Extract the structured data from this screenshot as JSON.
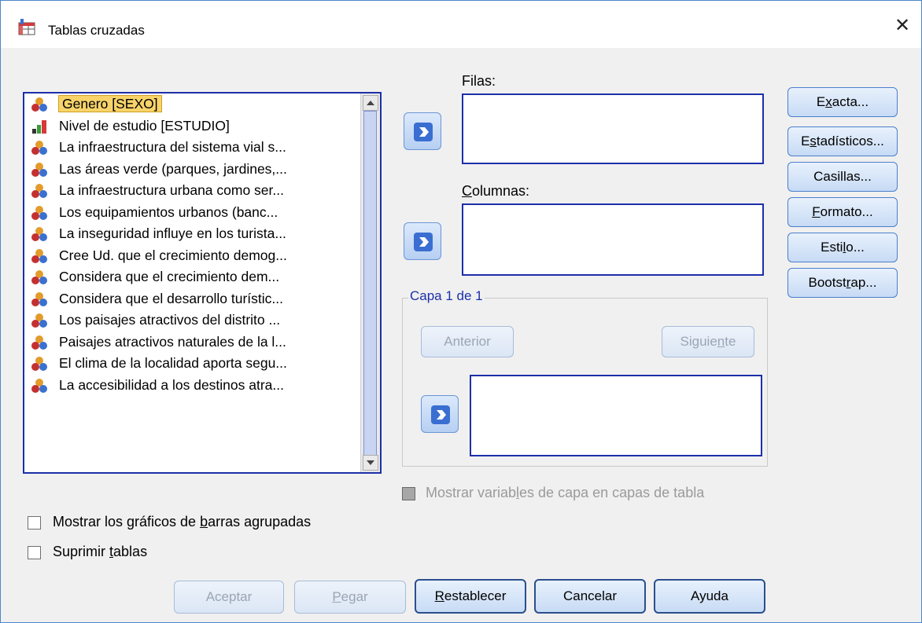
{
  "window": {
    "title": "Tablas cruzadas",
    "close_glyph": "✕"
  },
  "variables": [
    {
      "label": "Genero [SEXO]",
      "icon": "nominal-icon",
      "selected": true
    },
    {
      "label": "Nivel de estudio [ESTUDIO]",
      "icon": "ordinal-icon"
    },
    {
      "label": "La infraestructura del sistema vial s...",
      "icon": "nominal-icon"
    },
    {
      "label": "Las áreas verde (parques, jardines,...",
      "icon": "nominal-icon"
    },
    {
      "label": "La infraestructura urbana como ser...",
      "icon": "nominal-icon"
    },
    {
      "label": "Los equipamientos urbanos (banc...",
      "icon": "nominal-icon"
    },
    {
      "label": "La inseguridad influye en los turista...",
      "icon": "nominal-icon"
    },
    {
      "label": "Cree Ud. que el crecimiento demog...",
      "icon": "nominal-icon"
    },
    {
      "label": "Considera que el crecimiento dem...",
      "icon": "nominal-icon"
    },
    {
      "label": "Considera que el desarrollo turístic...",
      "icon": "nominal-icon"
    },
    {
      "label": "Los paisajes atractivos del distrito ...",
      "icon": "nominal-icon"
    },
    {
      "label": "Paisajes atractivos naturales de la l...",
      "icon": "nominal-icon"
    },
    {
      "label": "El clima de la localidad aporta segu...",
      "icon": "nominal-icon"
    },
    {
      "label": "La accesibilidad a los destinos atra...",
      "icon": "nominal-icon"
    }
  ],
  "rows_label": "Filas:",
  "columns_label": {
    "u": "C",
    "rest": "olumnas:"
  },
  "layer": {
    "title": "Capa 1 de 1",
    "prev": "Anterior",
    "next_a": "Siguie",
    "next_u": "n",
    "next_b": "te"
  },
  "show_layer": {
    "a": "Mostrar variab",
    "u": "l",
    "b": "es de capa en capas de tabla"
  },
  "side_buttons": [
    {
      "a": "E",
      "u": "x",
      "b": "acta..."
    },
    {
      "a": "E",
      "u": "s",
      "b": "tadísticos..."
    },
    {
      "a": "Casill",
      "u": "",
      "b": "as..."
    },
    {
      "a": "",
      "u": "F",
      "b": "ormato..."
    },
    {
      "a": "Esti",
      "u": "l",
      "b": "o..."
    },
    {
      "a": "Bootst",
      "u": "r",
      "b": "ap..."
    }
  ],
  "checks": [
    {
      "a": "Mostrar los gráficos de ",
      "u": "b",
      "b": "arras agrupadas"
    },
    {
      "a": "Suprimir ",
      "u": "t",
      "b": "ablas"
    }
  ],
  "bottom_buttons": {
    "ok": "Aceptar",
    "paste_u": "P",
    "paste_b": "egar",
    "reset_u": "R",
    "reset_b": "establecer",
    "cancel": "Cancelar",
    "help": "Ayuda"
  }
}
